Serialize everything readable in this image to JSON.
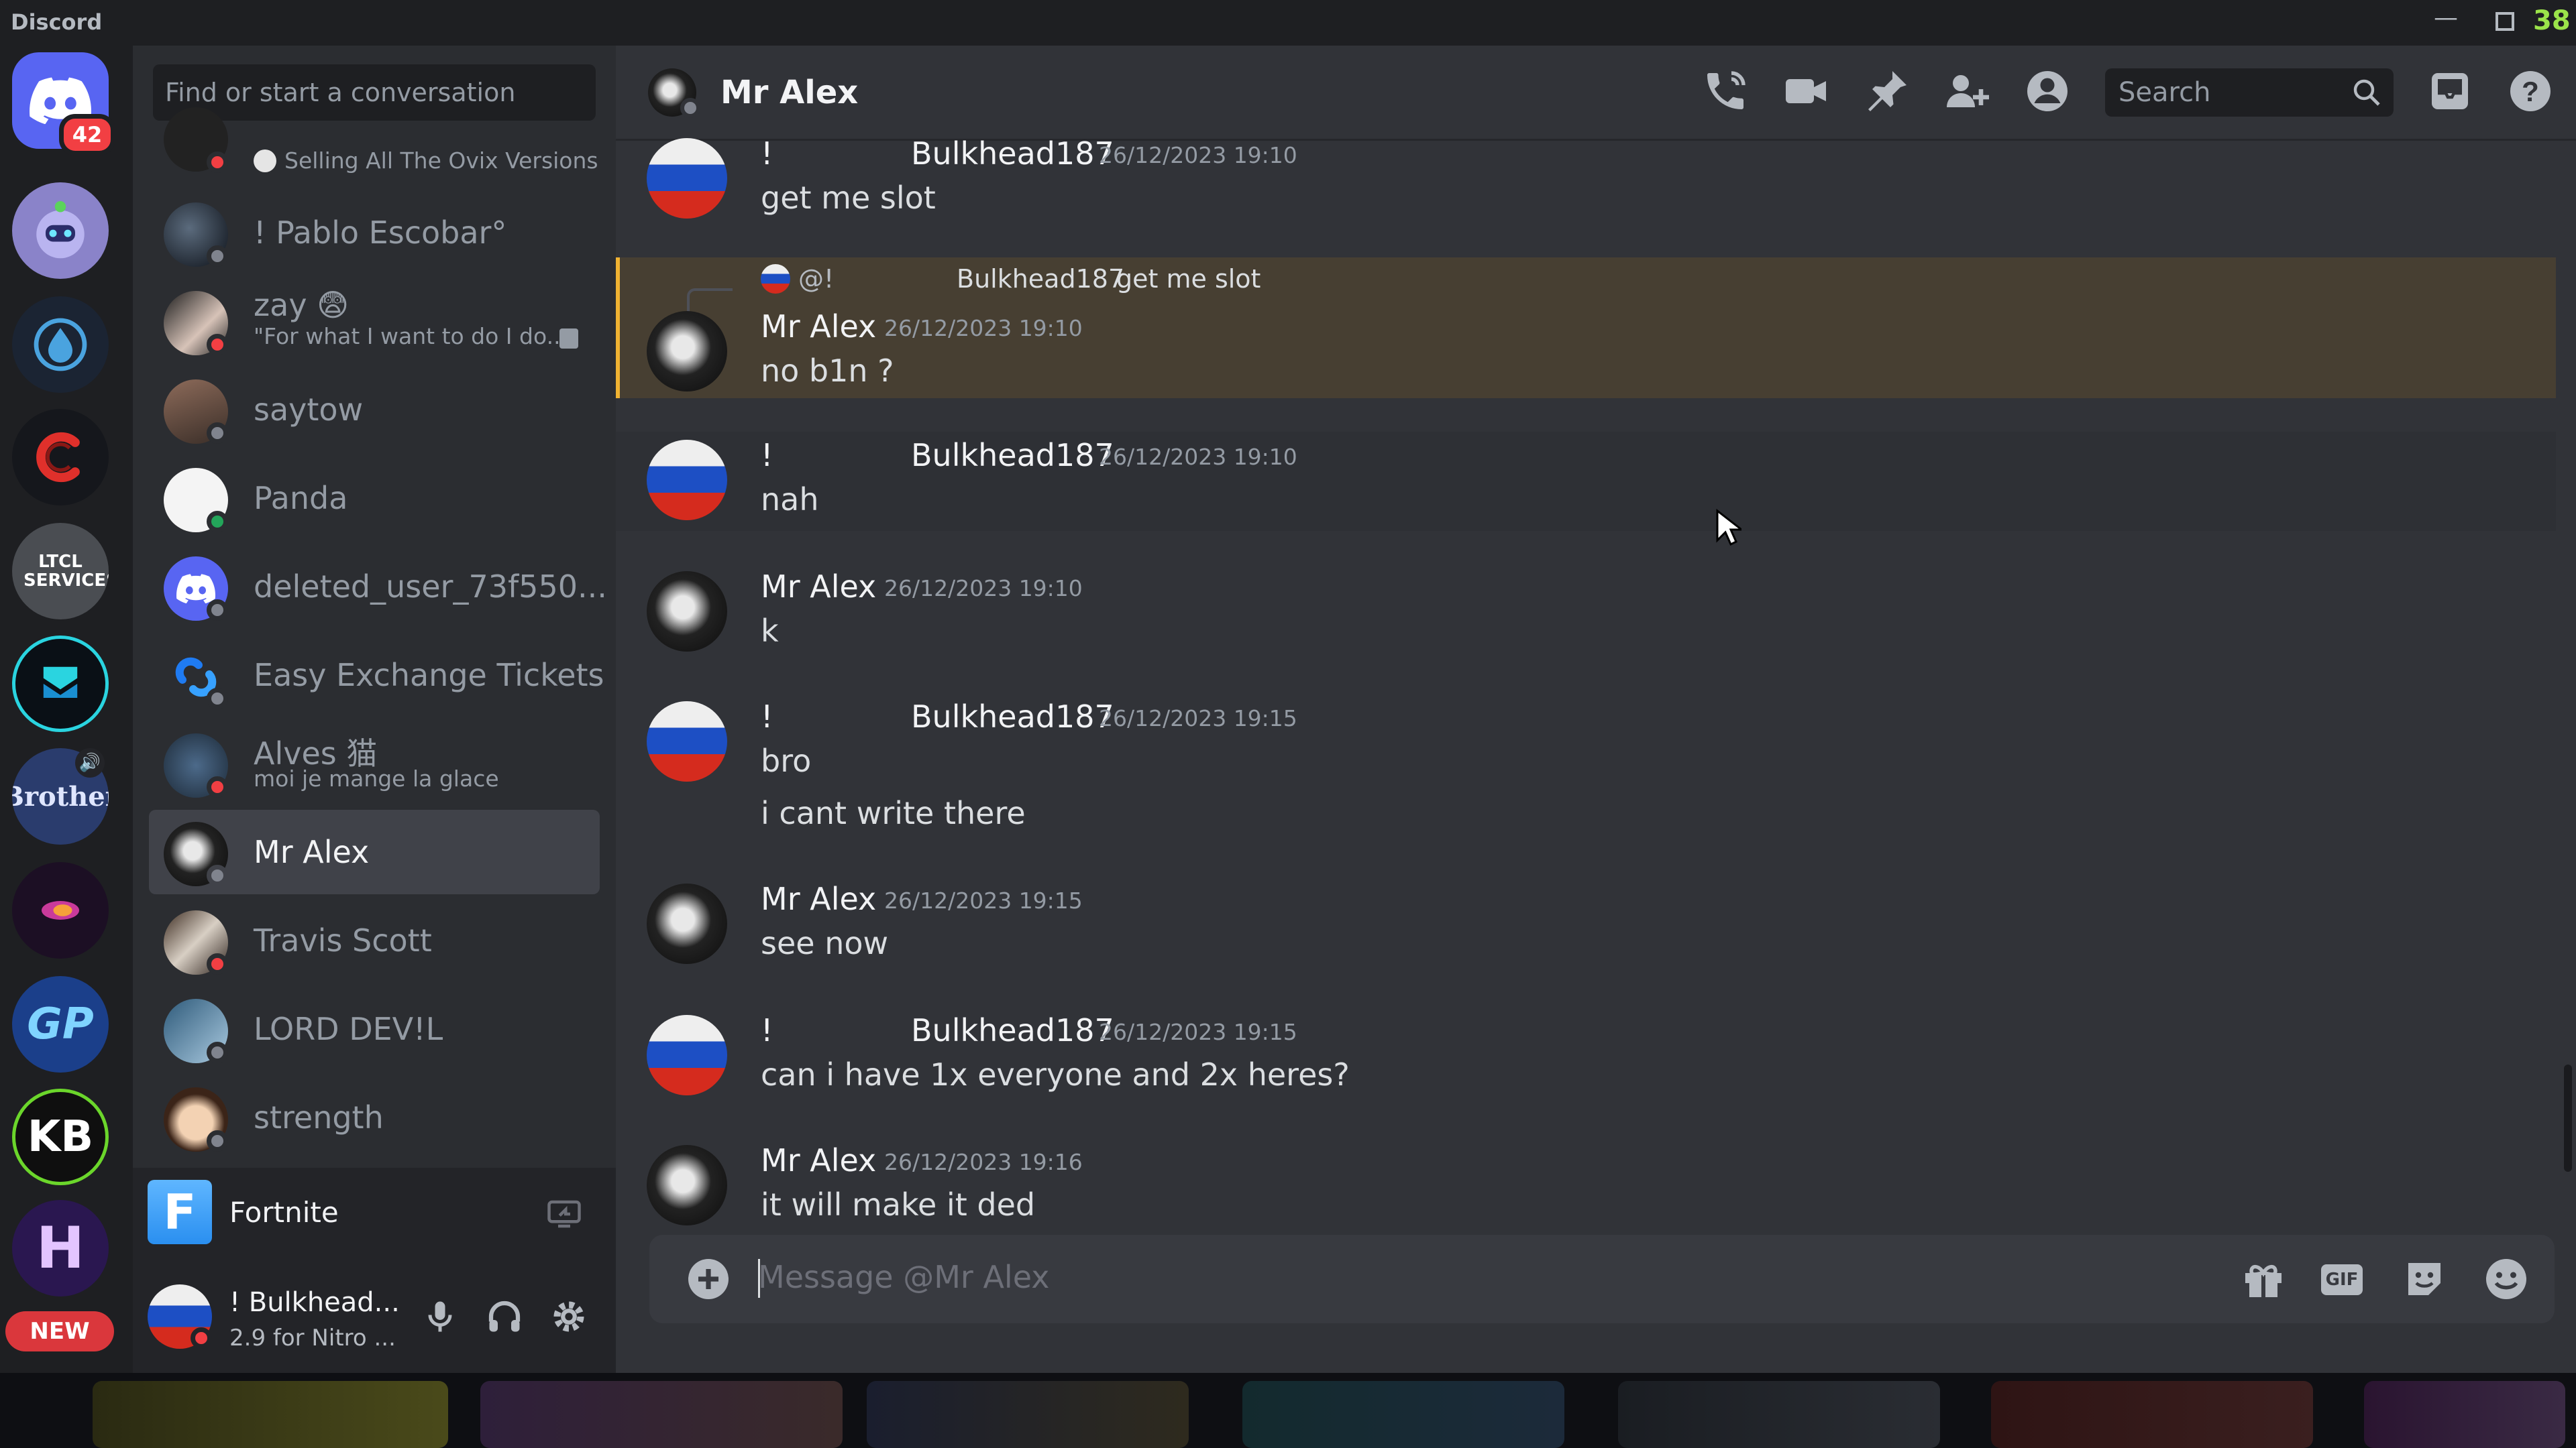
{
  "app": {
    "title": "Discord",
    "corner_badge": "38"
  },
  "rail": {
    "home_badge": "42",
    "new_label": "NEW",
    "servers": [
      {
        "name": "ltcl-services",
        "text": "LTCL SERVICES"
      },
      {
        "name": "brother-server",
        "text": "Brother"
      },
      {
        "name": "gp-server",
        "text": "GP"
      },
      {
        "name": "kb-server",
        "text": "KB"
      },
      {
        "name": "h-server",
        "text": "H"
      }
    ]
  },
  "sidebar": {
    "search_placeholder": "Find or start a conversation",
    "dms": [
      {
        "name": "",
        "sub": "Selling All The Ovix Versions",
        "status": "dnd"
      },
      {
        "name": "! Pablo Escobar°",
        "sub": "",
        "status": "offline"
      },
      {
        "name": "zay 😨",
        "sub": "\"For what I want to do I do...",
        "status": "dnd"
      },
      {
        "name": "saytow",
        "sub": "",
        "status": "offline"
      },
      {
        "name": "Panda",
        "sub": "",
        "status": "online"
      },
      {
        "name": "deleted_user_73f550...",
        "sub": "",
        "status": "offline"
      },
      {
        "name": "Easy Exchange Tickets",
        "sub": "",
        "status": "offline"
      },
      {
        "name": "Alves 猫",
        "sub": "moi je mange la glace",
        "status": "dnd"
      },
      {
        "name": "Mr Alex",
        "sub": "",
        "status": "offline"
      },
      {
        "name": "Travis Scott",
        "sub": "",
        "status": "dnd"
      },
      {
        "name": "LORD DEV!L",
        "sub": "",
        "status": "offline"
      },
      {
        "name": "strength",
        "sub": "",
        "status": "offline"
      }
    ],
    "now_playing": {
      "game": "Fortnite",
      "icon_letter": "F"
    },
    "user": {
      "name": "! Bulkhead...",
      "status_text": "2.9 for Nitro ..."
    }
  },
  "chat": {
    "header_name": "Mr Alex",
    "search_placeholder": "Search",
    "composer_placeholder": "Message @Mr Alex",
    "gif_label": "GIF",
    "reply_preview": {
      "prefix": "@!",
      "author": "Bulkhead187",
      "text": "get me slot"
    },
    "messages": [
      {
        "prefix": "!",
        "author": "Bulkhead187",
        "time": "26/12/2023 19:10",
        "lines": [
          "get me slot"
        ]
      },
      {
        "prefix": "",
        "author": "Mr Alex",
        "time": "26/12/2023 19:10",
        "lines": [
          "no b1n ?"
        ],
        "highlight": true
      },
      {
        "prefix": "!",
        "author": "Bulkhead187",
        "time": "26/12/2023 19:10",
        "lines": [
          "nah"
        ]
      },
      {
        "prefix": "",
        "author": "Mr Alex",
        "time": "26/12/2023 19:10",
        "lines": [
          "k"
        ]
      },
      {
        "prefix": "!",
        "author": "Bulkhead187",
        "time": "26/12/2023 19:15",
        "lines": [
          "bro",
          "i cant write there"
        ]
      },
      {
        "prefix": "",
        "author": "Mr Alex",
        "time": "26/12/2023 19:15",
        "lines": [
          "see now"
        ]
      },
      {
        "prefix": "!",
        "author": "Bulkhead187",
        "time": "26/12/2023 19:15",
        "lines": [
          "can i have 1x everyone and 2x heres?"
        ]
      },
      {
        "prefix": "",
        "author": "Mr Alex",
        "time": "26/12/2023 19:16",
        "lines": [
          "it will make it ded"
        ]
      }
    ]
  },
  "colors": {
    "blurple": "#5865f2",
    "online": "#23a55a",
    "dnd": "#f23f43",
    "offline": "#80848e",
    "mention_bg": "#473f32",
    "mention_bar": "#f0b232"
  }
}
